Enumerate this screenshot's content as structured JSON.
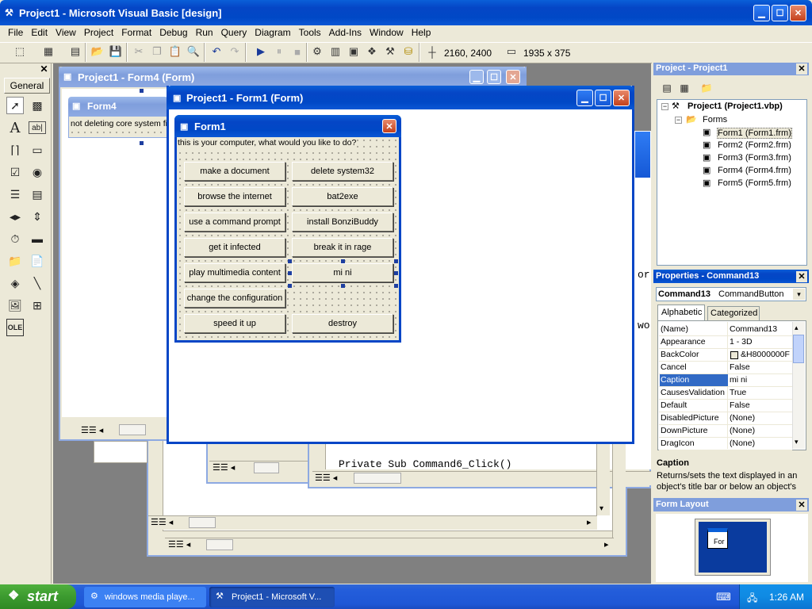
{
  "app": {
    "title": "Project1 - Microsoft Visual Basic [design]"
  },
  "menu": [
    "File",
    "Edit",
    "View",
    "Project",
    "Format",
    "Debug",
    "Run",
    "Query",
    "Diagram",
    "Tools",
    "Add-Ins",
    "Window",
    "Help"
  ],
  "toolbar": {
    "position": "2160, 2400",
    "size": "1935 x 375"
  },
  "toolbox": {
    "title": "General"
  },
  "form4_window": {
    "title": "Project1 - Form4 (Form)",
    "inner_title": "Form4",
    "label": "not deleting core system fi"
  },
  "form1_window": {
    "title": "Project1 - Form1 (Form)",
    "inner_title": "Form1",
    "label": "this is your computer, what would you like to do?",
    "buttons": [
      "make a document",
      "delete system32",
      "browse the internet",
      "bat2exe",
      "use a command prompt",
      "install BonziBuddy",
      "get it infected",
      "break it in rage",
      "play multimedia content",
      "mi ni",
      "change the configuration",
      "speed it up",
      "destroy"
    ]
  },
  "code_window": {
    "line": "Private Sub Command6_Click()",
    "frag1": "or",
    "frag2": "wo"
  },
  "project_explorer": {
    "title": "Project - Project1",
    "root": "Project1 (Project1.vbp)",
    "folder": "Forms",
    "items": [
      "Form1 (Form1.frm)",
      "Form2 (Form2.frm)",
      "Form3 (Form3.frm)",
      "Form4 (Form4.frm)",
      "Form5 (Form5.frm)"
    ]
  },
  "properties": {
    "title": "Properties - Command13",
    "object_name": "Command13",
    "object_type": "CommandButton",
    "tab_alpha": "Alphabetic",
    "tab_cat": "Categorized",
    "rows": [
      {
        "name": "(Name)",
        "value": "Command13"
      },
      {
        "name": "Appearance",
        "value": "1 - 3D"
      },
      {
        "name": "BackColor",
        "value": "&H8000000F"
      },
      {
        "name": "Cancel",
        "value": "False"
      },
      {
        "name": "Caption",
        "value": "mi ni"
      },
      {
        "name": "CausesValidation",
        "value": "True"
      },
      {
        "name": "Default",
        "value": "False"
      },
      {
        "name": "DisabledPicture",
        "value": "(None)"
      },
      {
        "name": "DownPicture",
        "value": "(None)"
      },
      {
        "name": "DragIcon",
        "value": "(None)"
      }
    ],
    "desc_title": "Caption",
    "desc_text": "Returns/sets the text displayed in an object's title bar or below an object's"
  },
  "form_layout": {
    "title": "Form Layout",
    "mini_label": "For"
  },
  "taskbar": {
    "start": "start",
    "tasks": [
      "windows media playe...",
      "Project1 - Microsoft V..."
    ],
    "clock": "1:26 AM"
  },
  "colors": {
    "accent": "#0a5fd8",
    "desktop_mdi": "#808080",
    "taskbar": "#245edb",
    "start": "#3c9a2f"
  }
}
